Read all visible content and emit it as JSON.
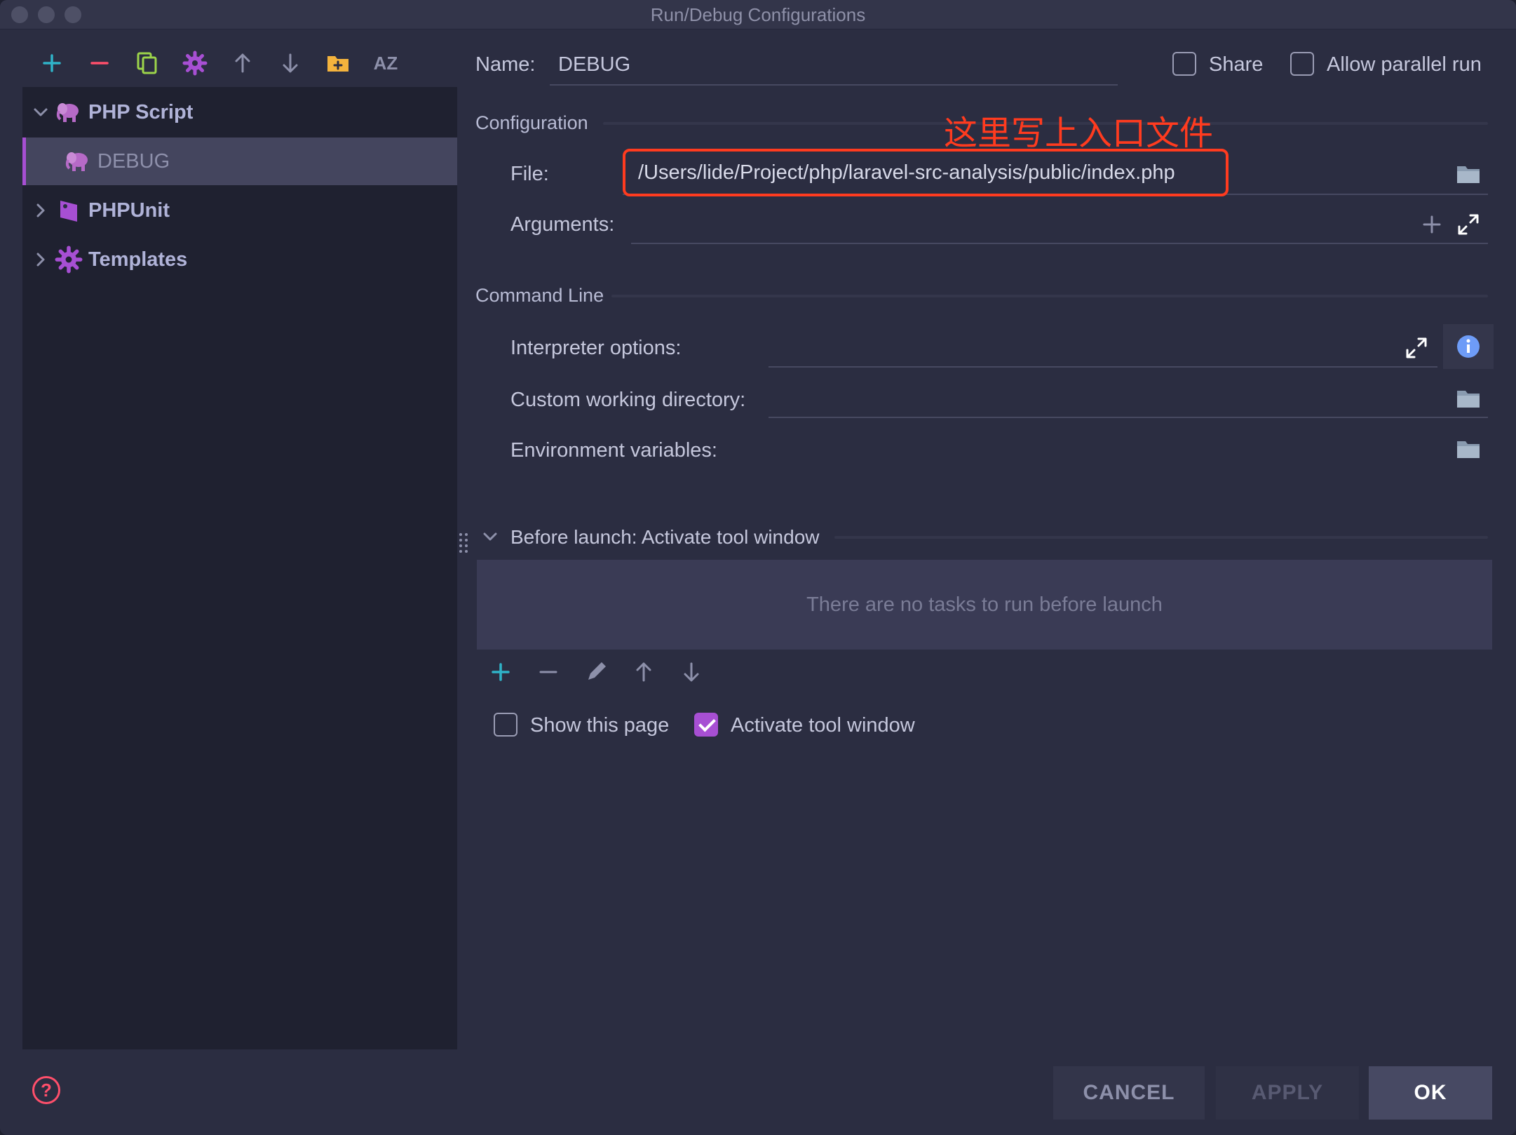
{
  "window": {
    "title": "Run/Debug Configurations"
  },
  "toolbar": {
    "icons": [
      "add-icon",
      "remove-icon",
      "copy-icon",
      "gear-icon",
      "arrow-up-icon",
      "arrow-down-icon",
      "new-folder-icon",
      "sort-az-icon"
    ],
    "sort_label": "AZ"
  },
  "tree": {
    "items": [
      {
        "label": "PHP Script",
        "expanded": true,
        "icon": "elephant-icon"
      },
      {
        "label": "DEBUG",
        "selected": true,
        "icon": "elephant-icon"
      },
      {
        "label": "PHPUnit",
        "expanded": false,
        "icon": "phpunit-icon"
      },
      {
        "label": "Templates",
        "expanded": false,
        "icon": "gear-icon"
      }
    ]
  },
  "form": {
    "name_label": "Name:",
    "name_value": "DEBUG",
    "share_label": "Share",
    "share_checked": false,
    "parallel_label": "Allow parallel run",
    "parallel_checked": false,
    "configuration_section": "Configuration",
    "file_label": "File:",
    "file_value": "/Users/lide/Project/php/laravel-src-analysis/public/index.php",
    "arguments_label": "Arguments:",
    "arguments_value": "",
    "command_line_section": "Command Line",
    "interpreter_label": "Interpreter options:",
    "working_dir_label": "Custom working directory:",
    "env_label": "Environment variables:"
  },
  "annotation": {
    "text": "这里写上入口文件",
    "color": "#ff3b1f"
  },
  "before_launch": {
    "title": "Before launch: Activate tool window",
    "empty_text": "There are no tasks to run before launch",
    "show_page_label": "Show this page",
    "show_page_checked": false,
    "activate_label": "Activate tool window",
    "activate_checked": true
  },
  "footer": {
    "help_symbol": "?",
    "cancel_label": "CANCEL",
    "apply_label": "APPLY",
    "ok_label": "OK"
  },
  "colors": {
    "accent": "#a74fd3",
    "background": "#2b2d41",
    "sidebar": "#1f2130",
    "add_green": "#2fb3c8",
    "remove_red": "#ff4f6b",
    "folder_yellow": "#f4b33d"
  }
}
